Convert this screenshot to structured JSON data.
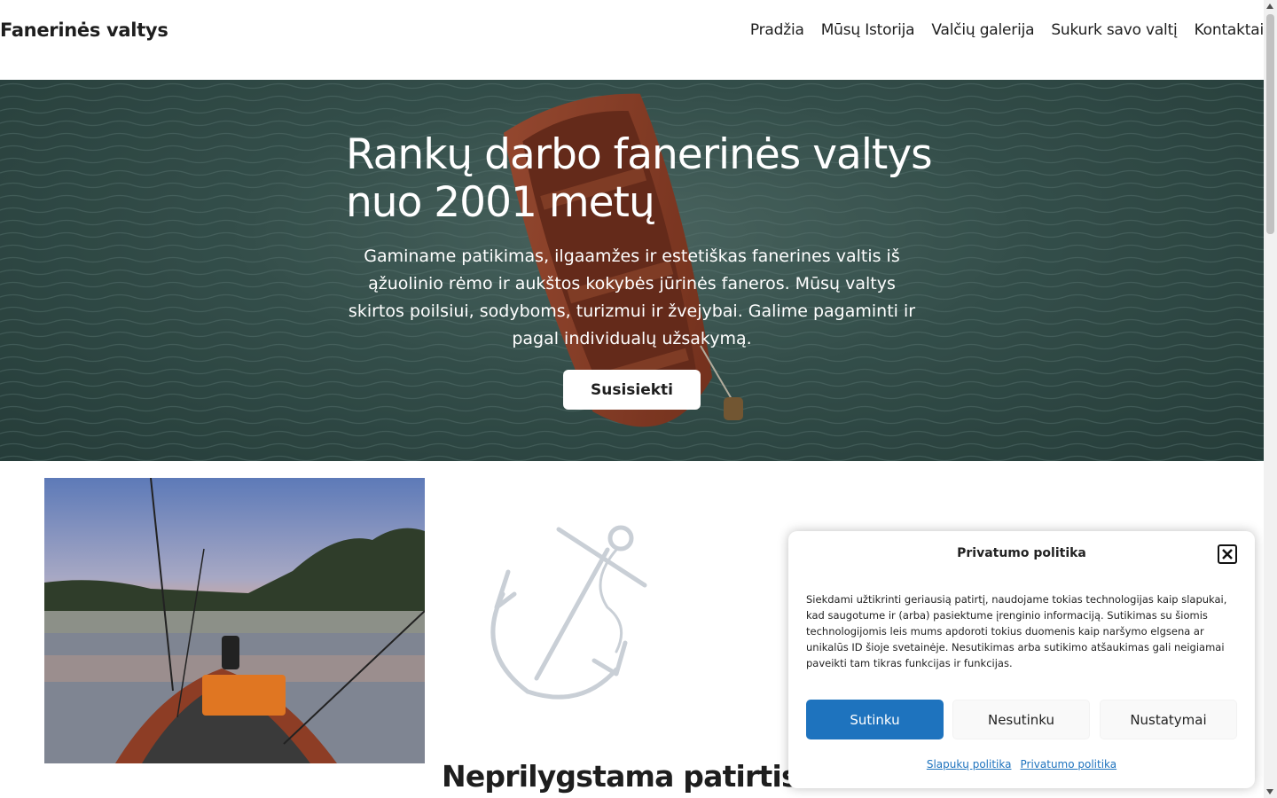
{
  "header": {
    "brand": "Fanerinės valtys",
    "nav": [
      "Pradžia",
      "Mūsų Istorija",
      "Valčių galerija",
      "Sukurk savo valtį",
      "Kontaktai"
    ]
  },
  "hero": {
    "title": "Rankų darbo fanerinės valtys nuo 2001 metų",
    "text": "Gaminame patikimas, ilgaamžes ir estetiškas fanerines valtis iš ąžuolinio rėmo ir aukštos kokybės jūrinės faneros. Mūsų valtys skirtos poilsiui, sodyboms, turizmui ir žvejybai. Galime pagaminti ir pagal individualų užsakymą.",
    "button": "Susisiekti"
  },
  "content": {
    "heading": "Neprilygstama patirtis"
  },
  "cookie": {
    "title": "Privatumo politika",
    "body": "Siekdami užtikrinti geriausią patirtį, naudojame tokias technologijas kaip slapukai, kad saugotume ir (arba) pasiektume įrenginio informaciją. Sutikimas su šiomis technologijomis leis mums apdoroti tokius duomenis kaip naršymo elgsena ar unikalūs ID šioje svetainėje. Nesutikimas arba sutikimo atšaukimas gali neigiamai paveikti tam tikras funkcijas ir funkcijas.",
    "accept": "Sutinku",
    "deny": "Nesutinku",
    "preferences": "Nustatymai",
    "links": [
      "Slapukų politika",
      "Privatumo politika"
    ],
    "accent_color": "#1e73be"
  },
  "icons": [
    "close-icon",
    "anchor-icon"
  ]
}
